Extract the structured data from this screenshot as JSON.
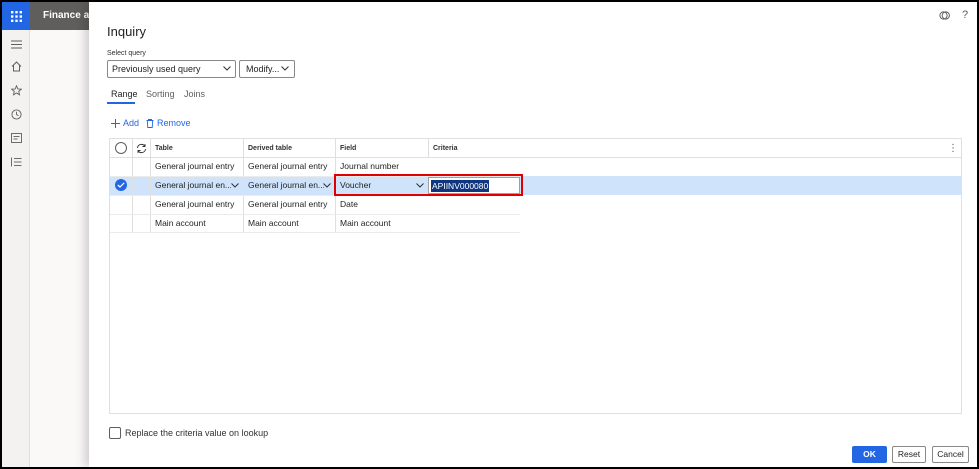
{
  "app": {
    "title": "Finance and"
  },
  "dialog": {
    "title": "Inquiry",
    "select_query_label": "Select query",
    "select_query_value": "Previously used query",
    "modify_label": "Modify...",
    "tabs": [
      {
        "label": "Range"
      },
      {
        "label": "Sorting"
      },
      {
        "label": "Joins"
      }
    ],
    "actions": {
      "add": "Add",
      "remove": "Remove"
    },
    "grid": {
      "headers": {
        "table": "Table",
        "derived": "Derived table",
        "field": "Field",
        "criteria": "Criteria"
      },
      "rows": [
        {
          "table": "General journal entry",
          "derived": "General journal entry",
          "field": "Journal number",
          "criteria": ""
        },
        {
          "table": "General journal en...",
          "derived": "General journal en...",
          "field": "Voucher",
          "criteria": "APIINV000080"
        },
        {
          "table": "General journal entry",
          "derived": "General journal entry",
          "field": "Date",
          "criteria": ""
        },
        {
          "table": "Main account",
          "derived": "Main account",
          "field": "Main account",
          "criteria": ""
        }
      ]
    },
    "replace_label": "Replace the criteria value on lookup",
    "buttons": {
      "ok": "OK",
      "reset": "Reset",
      "cancel": "Cancel"
    }
  },
  "icons": [
    "waffle-icon",
    "hamburger-icon",
    "home-icon",
    "star-icon",
    "clock-icon",
    "workspace-icon",
    "list-icon",
    "feedback-icon",
    "help-icon",
    "add-icon",
    "delete-icon",
    "refresh-icon",
    "chevron-down-icon",
    "check-icon",
    "more-icon"
  ],
  "colors": {
    "accent": "#2266e3",
    "selected_row": "#cfe4fa",
    "highlight": "#e00000",
    "topbar": "#605e5c"
  }
}
